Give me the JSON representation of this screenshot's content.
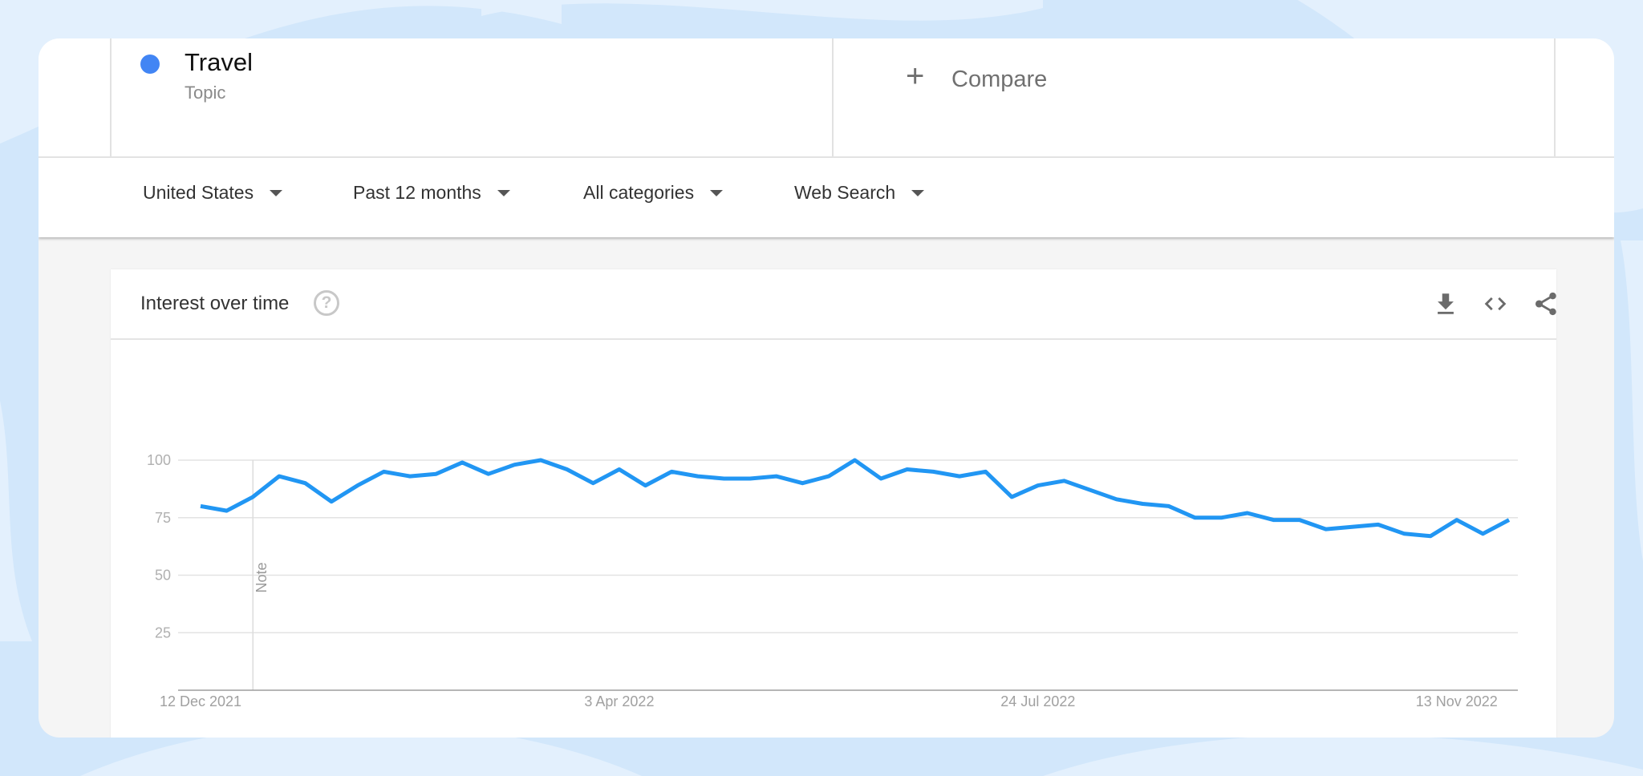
{
  "term": {
    "name": "Travel",
    "type": "Topic",
    "color": "#4285f4"
  },
  "compare": {
    "label": "Compare",
    "icon": "plus-icon"
  },
  "filters": [
    {
      "label": "United States"
    },
    {
      "label": "Past 12 months"
    },
    {
      "label": "All categories"
    },
    {
      "label": "Web Search"
    }
  ],
  "chart_header": {
    "title": "Interest over time",
    "help_icon": "?",
    "actions": [
      "download-icon",
      "embed-code-icon",
      "share-icon"
    ]
  },
  "chart_data": {
    "type": "line",
    "title": "Interest over time",
    "xlabel": "",
    "ylabel": "",
    "ylim": [
      0,
      100
    ],
    "yticks": [
      25,
      50,
      75,
      100
    ],
    "xtick_labels": [
      {
        "index": 0,
        "label": "12 Dec 2021"
      },
      {
        "index": 16,
        "label": "3 Apr 2022"
      },
      {
        "index": 32,
        "label": "24 Jul 2022"
      },
      {
        "index": 48,
        "label": "13 Nov 2022"
      }
    ],
    "grid": true,
    "annotation": {
      "index": 2,
      "label": "Note"
    },
    "series": [
      {
        "name": "Travel",
        "color": "#2196f3",
        "values": [
          80,
          78,
          84,
          93,
          90,
          82,
          89,
          95,
          93,
          94,
          99,
          94,
          98,
          100,
          96,
          90,
          96,
          89,
          95,
          93,
          92,
          92,
          93,
          90,
          93,
          100,
          92,
          96,
          95,
          93,
          95,
          84,
          89,
          91,
          87,
          83,
          81,
          80,
          75,
          75,
          77,
          74,
          74,
          70,
          71,
          72,
          68,
          67,
          74,
          68,
          74
        ]
      }
    ]
  }
}
